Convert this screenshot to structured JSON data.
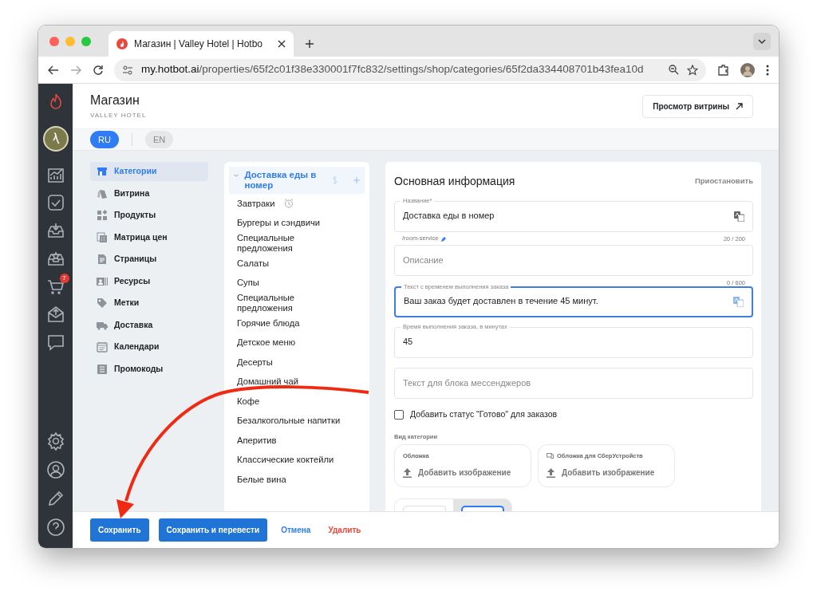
{
  "browser": {
    "tab_title": "Магазин | Valley Hotel | Hotbo",
    "url_host": "my.hotbot.ai",
    "url_path": "/properties/65f2c01f38e330001f7fc832/settings/shop/categories/65f2da334408701b43fea10d"
  },
  "rail": {
    "cart_badge": "7"
  },
  "header": {
    "title": "Магазин",
    "subtitle": "VALLEY HOTEL",
    "preview_button": "Просмотр витрины"
  },
  "languages": [
    {
      "label": "RU",
      "selected": true
    },
    {
      "label": "EN",
      "selected": false
    }
  ],
  "menu": [
    {
      "label": "Категории",
      "selected": true
    },
    {
      "label": "Витрина",
      "selected": false
    },
    {
      "label": "Продукты",
      "selected": false
    },
    {
      "label": "Матрица цен",
      "selected": false
    },
    {
      "label": "Страницы",
      "selected": false
    },
    {
      "label": "Ресурсы",
      "selected": false
    },
    {
      "label": "Метки",
      "selected": false
    },
    {
      "label": "Доставка",
      "selected": false
    },
    {
      "label": "Календари",
      "selected": false
    },
    {
      "label": "Промокоды",
      "selected": false
    }
  ],
  "categories": [
    {
      "label": "Доставка еды в номер",
      "expanded": true,
      "selected": true,
      "children": [
        {
          "label": "Завтраки",
          "scheduled": true
        },
        {
          "label": "Бургеры и сэндвичи",
          "scheduled": false
        },
        {
          "label": "Специальные предложения",
          "scheduled": false
        },
        {
          "label": "Салаты",
          "scheduled": false
        },
        {
          "label": "Супы",
          "scheduled": false
        },
        {
          "label": "Специальные предложения",
          "scheduled": false
        },
        {
          "label": "Горячие блюда",
          "scheduled": false
        },
        {
          "label": "Детское меню",
          "scheduled": false
        },
        {
          "label": "Десерты",
          "scheduled": false
        },
        {
          "label": "Домашний чай",
          "scheduled": false
        },
        {
          "label": "Кофе",
          "scheduled": false
        },
        {
          "label": "Безалкогольные напитки",
          "scheduled": false
        },
        {
          "label": "Аперитив",
          "scheduled": false
        },
        {
          "label": "Классические коктейли",
          "scheduled": false
        },
        {
          "label": "Белые вина",
          "scheduled": false
        }
      ]
    }
  ],
  "form": {
    "title": "Основная информация",
    "suspend_link": "Приостановить",
    "fields": [
      {
        "label": "Название*",
        "value": "Доставка еды в номер",
        "focused": false,
        "translatable": true,
        "slug": "/room-service",
        "counter": "20 / 200"
      },
      {
        "placeholder": "Описание",
        "focused": false,
        "translatable": false,
        "counter": "0 / 600"
      },
      {
        "label": "Текст с временем выполнения заказа",
        "value": "Ваш заказ будет доставлен в течение 45 минут.",
        "focused": true,
        "translatable": true
      },
      {
        "label": "Время выполнения заказа, в минутах",
        "value": "45",
        "focused": false,
        "translatable": false
      },
      {
        "placeholder": "Текст для блока мессенджеров",
        "focused": false,
        "translatable": false
      }
    ],
    "ready_status": {
      "label": "Добавить статус \"Готово\" для заказов",
      "checked": false
    },
    "view_label": "Вид категории",
    "image_slots": [
      {
        "kind": "cover",
        "label": "Обложка",
        "action": "Добавить изображение"
      },
      {
        "kind": "device",
        "label": "Обложка для СберУстройств",
        "action": "Добавить изображение"
      }
    ],
    "layout_options": [
      {
        "selected": false
      },
      {
        "selected": true
      }
    ]
  },
  "actions": [
    {
      "kind": "primary",
      "label": "Сохранить"
    },
    {
      "kind": "primary",
      "label": "Сохранить и перевести"
    },
    {
      "kind": "link",
      "label": "Отмена"
    },
    {
      "kind": "danger",
      "label": "Удалить"
    }
  ]
}
